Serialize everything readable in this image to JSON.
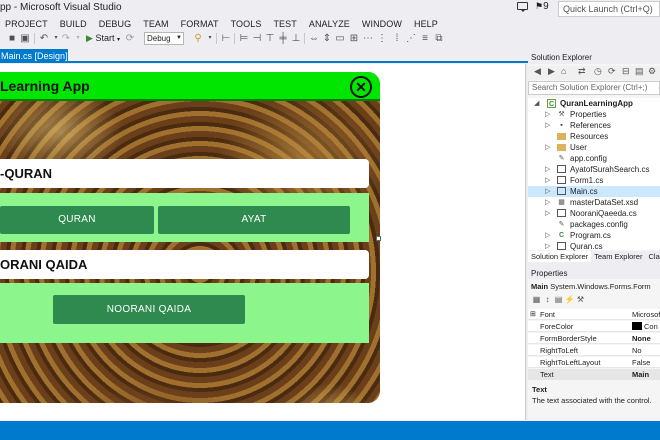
{
  "window": {
    "title": "pp - Microsoft Visual Studio",
    "notification_count": "9",
    "quick_launch_placeholder": "Quick Launch (Ctrl+Q)"
  },
  "menu": [
    "PROJECT",
    "BUILD",
    "DEBUG",
    "TEAM",
    "FORMAT",
    "TOOLS",
    "TEST",
    "ANALYZE",
    "WINDOW",
    "HELP"
  ],
  "toolbar": {
    "start_label": "Start",
    "config_value": "Debug"
  },
  "tabs": {
    "active_label": "Main.cs [Design]*",
    "close_symbol": "✕"
  },
  "form": {
    "title": "Learning App",
    "quran_label": "-QURAN",
    "quran_button": "QURAN",
    "ayat_button": "AYAT",
    "qaida_label": "ORANI QAIDA",
    "noorani_button": "NOORANI QAIDA",
    "header_color": "#00e600",
    "panel_color": "#8cf58c",
    "button_color": "#2f8a4f"
  },
  "solution_explorer": {
    "title": "Solution Explorer",
    "search_placeholder": "Search Solution Explorer (Ctrl+;)",
    "tree": [
      {
        "label": "QuranLearningApp",
        "icon": "csharp-project-icon",
        "bold": true
      },
      {
        "label": "Properties",
        "icon": "wrench-icon"
      },
      {
        "label": "References",
        "icon": "references-icon"
      },
      {
        "label": "Resources",
        "icon": "folder-icon"
      },
      {
        "label": "User",
        "icon": "folder-icon"
      },
      {
        "label": "app.config",
        "icon": "config-file-icon"
      },
      {
        "label": "AyatofSurahSearch.cs",
        "icon": "form-file-icon"
      },
      {
        "label": "Form1.cs",
        "icon": "form-file-icon"
      },
      {
        "label": "Main.cs",
        "icon": "form-file-icon",
        "selected": true
      },
      {
        "label": "masterDataSet.xsd",
        "icon": "dataset-file-icon"
      },
      {
        "label": "NooraniQaeeda.cs",
        "icon": "form-file-icon"
      },
      {
        "label": "packages.config",
        "icon": "config-file-icon"
      },
      {
        "label": "Program.cs",
        "icon": "csharp-file-icon"
      },
      {
        "label": "Quran.cs",
        "icon": "form-file-icon"
      }
    ],
    "tabs": [
      "Solution Explorer",
      "Team Explorer",
      "Class"
    ]
  },
  "properties": {
    "title": "Properties",
    "object_name": "Main",
    "object_type": "System.Windows.Forms.Form",
    "rows": [
      {
        "name": "Font",
        "value": "Microsof",
        "expandable": true
      },
      {
        "name": "ForeColor",
        "value": "Con",
        "swatch": "#000000"
      },
      {
        "name": "FormBorderStyle",
        "value": "None",
        "bold": true
      },
      {
        "name": "RightToLeft",
        "value": "No"
      },
      {
        "name": "RightToLeftLayout",
        "value": "False"
      },
      {
        "name": "Text",
        "value": "Main",
        "bold": true,
        "selected": true
      }
    ],
    "description_title": "Text",
    "description_text": "The text associated with the control."
  },
  "colors": {
    "accent": "#007acc",
    "selection": "#cce8ff"
  }
}
